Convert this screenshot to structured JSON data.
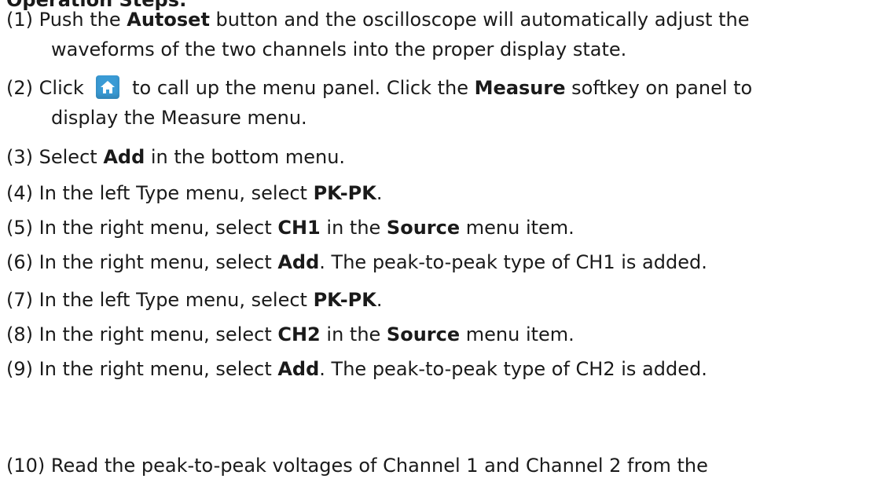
{
  "heading_partial": "Operation Steps:",
  "steps": [
    {
      "num": "(1)",
      "line1_pre": "Push the ",
      "line1_bold": "Autoset",
      "line1_post": " button and the oscilloscope will automatically adjust the",
      "line2": "waveforms of the two channels into the proper display state."
    },
    {
      "num": "(2)",
      "line1_pre": "Click ",
      "line1_mid": " to call up the menu panel. Click the ",
      "line1_bold": "Measure",
      "line1_post": " softkey on panel to",
      "line2": "display the Measure menu."
    },
    {
      "num": "(3)",
      "pre": "Select ",
      "bold": "Add",
      "post": " in the bottom menu."
    },
    {
      "num": "(4)",
      "pre": "In the left Type menu, select ",
      "bold": "PK-PK",
      "post": "."
    },
    {
      "num": "(5)",
      "pre": "In the right menu, select ",
      "bold": "CH1",
      "mid": " in the ",
      "bold2": "Source",
      "post": " menu item."
    },
    {
      "num": "(6)",
      "pre": "In the right menu, select ",
      "bold": "Add",
      "post": ". The peak-to-peak type of CH1 is added."
    },
    {
      "num": "(7)",
      "pre": "In the left Type menu, select ",
      "bold": "PK-PK",
      "post": "."
    },
    {
      "num": "(8)",
      "pre": "In the right menu, select ",
      "bold": "CH2",
      "mid": " in the ",
      "bold2": "Source",
      "post": " menu item."
    },
    {
      "num": "(9)",
      "pre": "In the right menu, select ",
      "bold": "Add",
      "post": ". The peak-to-peak type of CH2 is added."
    },
    {
      "num": "(10)",
      "text": "Read the peak-to-peak voltages of Channel 1 and Channel 2 from the"
    }
  ],
  "icons": {
    "home": "home-icon",
    "home_color": "#3a9bd5"
  }
}
